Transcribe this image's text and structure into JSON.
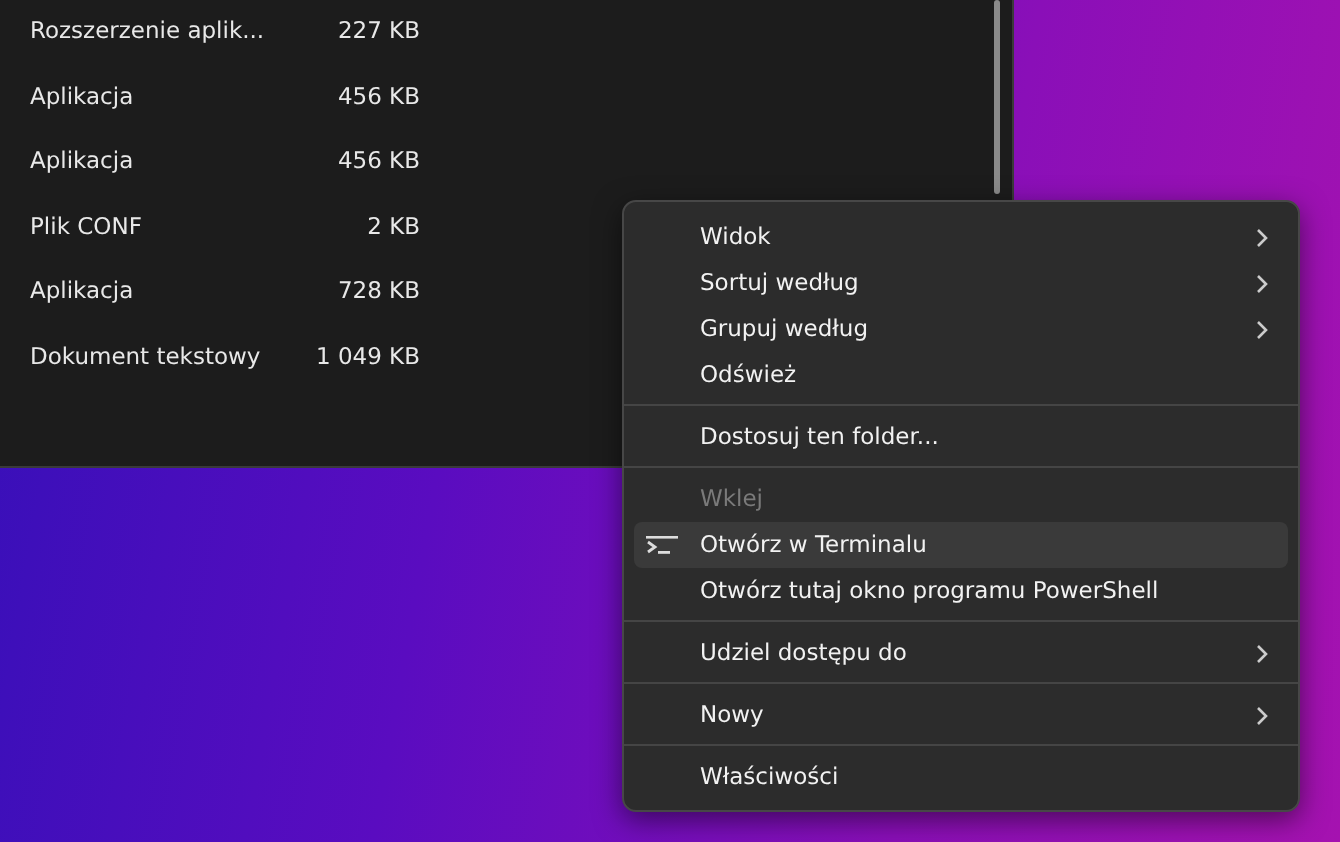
{
  "file_list": {
    "rows": [
      {
        "type": "Rozszerzenie aplik...",
        "size": "227 KB"
      },
      {
        "type": "Aplikacja",
        "size": "456 KB"
      },
      {
        "type": "Aplikacja",
        "size": "456 KB"
      },
      {
        "type": "Plik CONF",
        "size": "2 KB"
      },
      {
        "type": "Aplikacja",
        "size": "728 KB"
      },
      {
        "type": "Dokument tekstowy",
        "size": "1 049 KB"
      }
    ]
  },
  "context_menu": {
    "items": [
      {
        "kind": "item",
        "label": "Widok",
        "submenu": true,
        "disabled": false,
        "highlighted": false
      },
      {
        "kind": "item",
        "label": "Sortuj według",
        "submenu": true,
        "disabled": false,
        "highlighted": false
      },
      {
        "kind": "item",
        "label": "Grupuj według",
        "submenu": true,
        "disabled": false,
        "highlighted": false
      },
      {
        "kind": "item",
        "label": "Odśwież",
        "submenu": false,
        "disabled": false,
        "highlighted": false
      },
      {
        "kind": "separator"
      },
      {
        "kind": "item",
        "label": "Dostosuj ten folder...",
        "submenu": false,
        "disabled": false,
        "highlighted": false
      },
      {
        "kind": "separator"
      },
      {
        "kind": "item",
        "label": "Wklej",
        "submenu": false,
        "disabled": true,
        "highlighted": false
      },
      {
        "kind": "terminal",
        "label": "Otwórz w Terminalu",
        "submenu": false,
        "disabled": false,
        "highlighted": true
      },
      {
        "kind": "item",
        "label": "Otwórz tutaj okno programu PowerShell",
        "submenu": false,
        "disabled": false,
        "highlighted": false
      },
      {
        "kind": "separator"
      },
      {
        "kind": "item",
        "label": "Udziel dostępu do",
        "submenu": true,
        "disabled": false,
        "highlighted": false
      },
      {
        "kind": "separator"
      },
      {
        "kind": "item",
        "label": "Nowy",
        "submenu": true,
        "disabled": false,
        "highlighted": false
      },
      {
        "kind": "separator"
      },
      {
        "kind": "item",
        "label": "Właściwości",
        "submenu": false,
        "disabled": false,
        "highlighted": false
      }
    ]
  }
}
